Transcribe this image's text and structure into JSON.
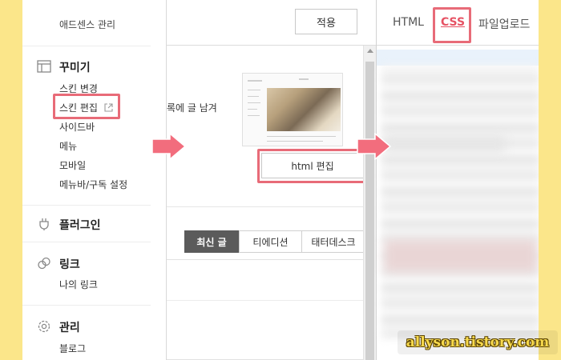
{
  "sidebar": {
    "top_item": "애드센스 관리",
    "sections": [
      {
        "title": "꾸미기",
        "icon": "layout-icon",
        "items": [
          "스킨 변경",
          "스킨 편집",
          "사이드바",
          "메뉴",
          "모바일",
          "메뉴바/구독 설정"
        ]
      },
      {
        "title": "플러그인",
        "icon": "plug-icon",
        "items": []
      },
      {
        "title": "링크",
        "icon": "link-icon",
        "items": [
          "나의 링크"
        ]
      },
      {
        "title": "관리",
        "icon": "gear-icon",
        "items": [
          "블로그"
        ]
      }
    ],
    "highlighted_item": "스킨 편집"
  },
  "middle": {
    "apply_button": "적용",
    "partial_text": "록에 글 남겨",
    "html_edit_button": "html 편집",
    "tabs": [
      "최신 글",
      "티에디션",
      "태터데스크"
    ],
    "active_tab": "최신 글"
  },
  "editor": {
    "tabs": [
      "HTML",
      "CSS",
      "파일업로드"
    ],
    "active_tab": "CSS"
  },
  "colors": {
    "highlight": "#e86b78",
    "arrow": "#f26d7d",
    "background": "#fbe68a",
    "active_tab_bg": "#5b5b5b"
  },
  "watermark": "allyson.tistory.com"
}
